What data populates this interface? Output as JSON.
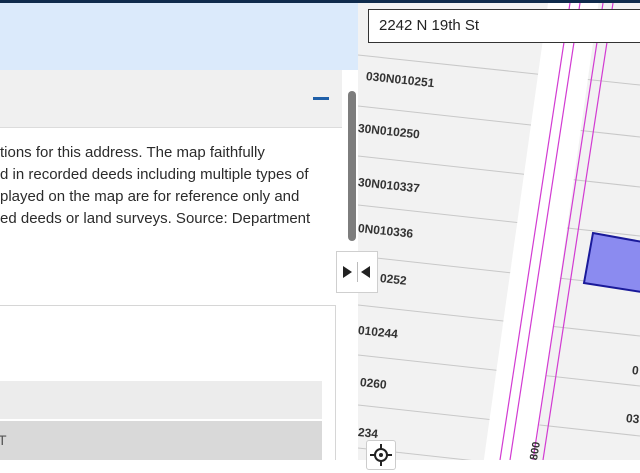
{
  "search": {
    "value": "2242 N 19th St",
    "placeholder": ""
  },
  "panel": {
    "disclaimer_lines": [
      "tions for this address. The map faithfully",
      "d in recorded deeds including multiple types of",
      "played on the map are for reference only and",
      "ed deeds or land surveys. Source: Department"
    ],
    "table_row_text": "T"
  },
  "map": {
    "parcel_labels": [
      "030N010251",
      "30N010250",
      "30N010337",
      "0N010336",
      "0252",
      "010244",
      "0260",
      "234"
    ],
    "edge_labels": [
      "0",
      "03"
    ],
    "street_fragment": "800"
  },
  "colors": {
    "header_band": "#dbeafb",
    "parcel_highlight": "#8b8bf0",
    "street_lines": "#d23bd2"
  }
}
